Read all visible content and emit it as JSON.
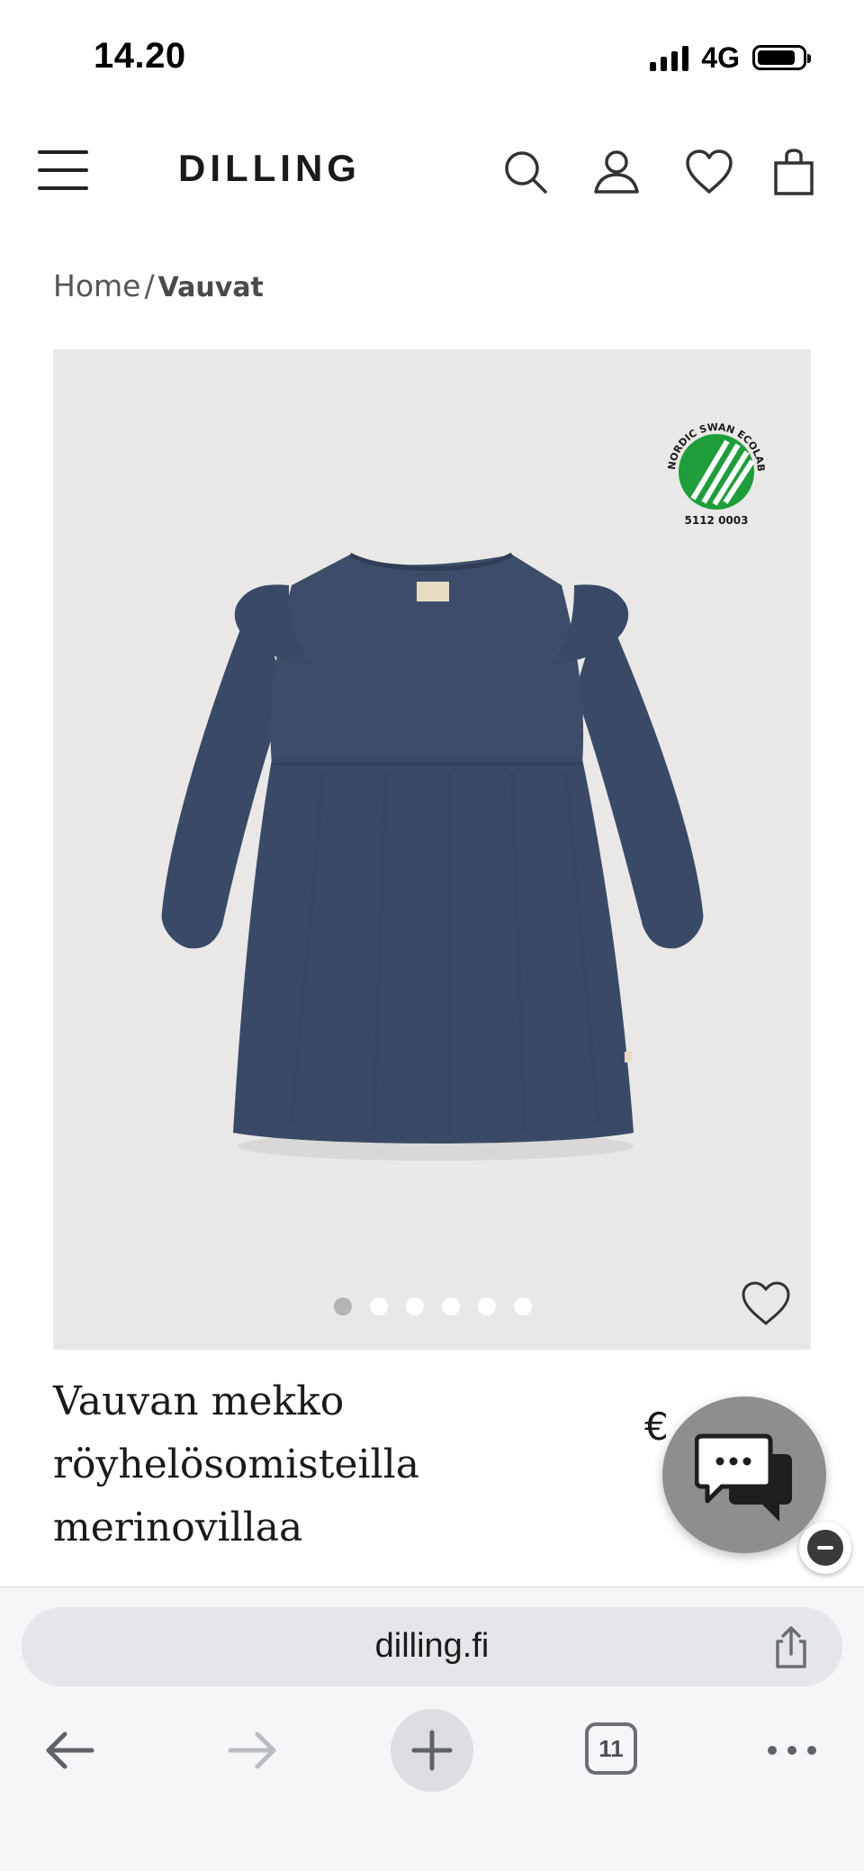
{
  "status_bar": {
    "time": "14.20",
    "network": "4G"
  },
  "header": {
    "logo": "DILLING",
    "icons": [
      "menu-icon",
      "search-icon",
      "account-icon",
      "heart-icon",
      "bag-icon"
    ]
  },
  "breadcrumb": {
    "home": "Home",
    "separator": "/",
    "current": "Vauvat"
  },
  "product": {
    "image_dots_count": 6,
    "active_image": 1,
    "ecolabel_code": "5112 0003",
    "title_lines": [
      "Vauvan mekko",
      "röyhelösomisteilla",
      "merinovillaa"
    ],
    "price_visible": "€",
    "dress_color": "#3a4a66"
  },
  "browser": {
    "url": "dilling.fi",
    "tab_count": "11"
  },
  "colors": {
    "image_bg": "#e9e8e6",
    "ecolabel_green": "#1e9e3a",
    "chat_bubble": "#8e8e8e"
  }
}
